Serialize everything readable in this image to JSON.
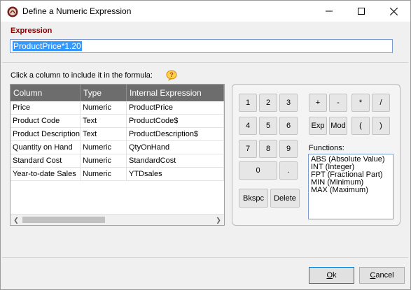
{
  "window": {
    "title": "Define a Numeric Expression"
  },
  "expression": {
    "label": "Expression",
    "value": "ProductPrice*1.20"
  },
  "instruction": "Click a column to include it in the formula:",
  "grid": {
    "headers": [
      "Column",
      "Type",
      "Internal Expression"
    ],
    "rows": [
      [
        "Price",
        "Numeric",
        "ProductPrice"
      ],
      [
        "Product Code",
        "Text",
        "ProductCode$"
      ],
      [
        "Product Description",
        "Text",
        "ProductDescription$"
      ],
      [
        "Quantity on Hand",
        "Numeric",
        "QtyOnHand"
      ],
      [
        "Standard Cost",
        "Numeric",
        "StandardCost"
      ],
      [
        "Year-to-date Sales",
        "Numeric",
        "YTDsales"
      ]
    ]
  },
  "keypad": {
    "digits": [
      "1",
      "2",
      "3",
      "4",
      "5",
      "6",
      "7",
      "8",
      "9",
      "0",
      "."
    ],
    "operators": [
      "+",
      "-",
      "*",
      "/",
      "Exp",
      "Mod",
      "(",
      ")"
    ],
    "backspace": "Bkspc",
    "delete": "Delete",
    "functions_label": "Functions:",
    "functions": [
      "ABS  (Absolute Value)",
      "INT  (Integer)",
      "FPT  (Fractional Part)",
      "MIN  (Minimum)",
      "MAX  (Maximum)"
    ]
  },
  "buttons": {
    "ok_first": "O",
    "ok_rest": "k",
    "cancel_first": "C",
    "cancel_rest": "ancel"
  },
  "colors": {
    "expression_label": "#8b0000",
    "selection": "#3399ff",
    "grid_header": "#6d6d6d"
  }
}
